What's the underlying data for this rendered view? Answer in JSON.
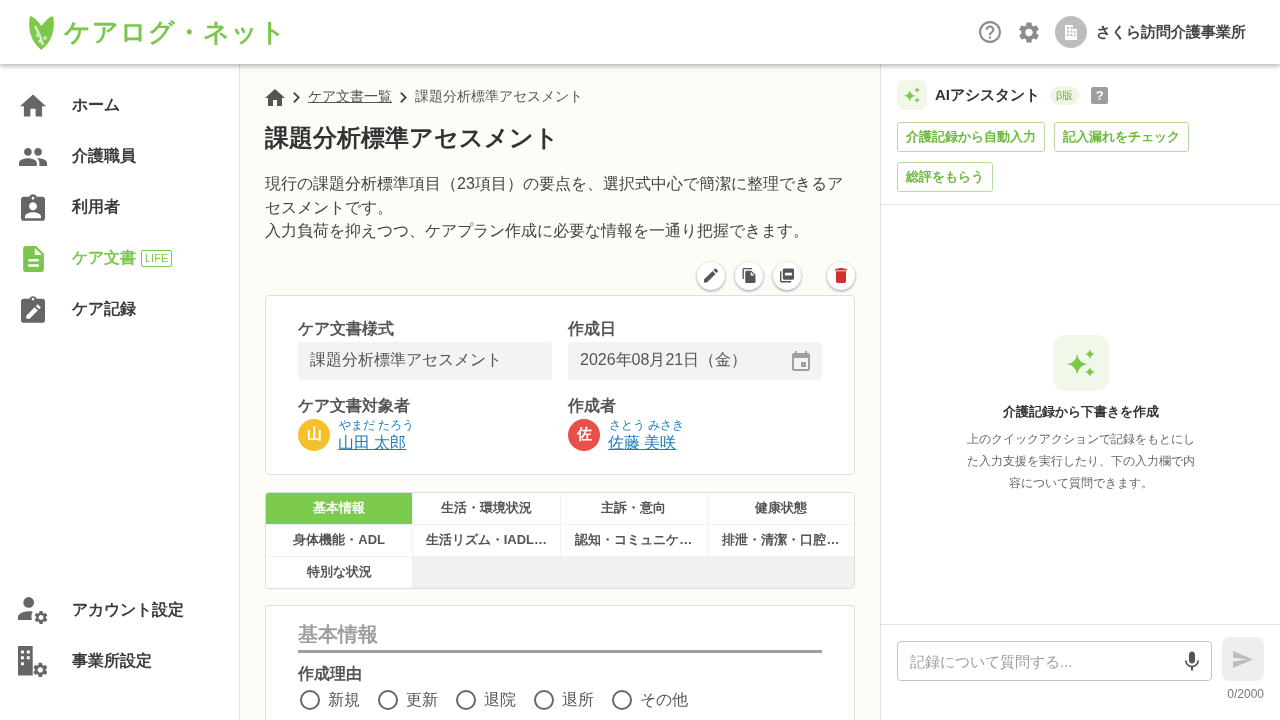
{
  "header": {
    "logo": "ケアログ・ネット",
    "account": "さくら訪問介護事業所"
  },
  "sidebar": {
    "items": [
      {
        "label": "ホーム",
        "selected": false
      },
      {
        "label": "介護職員",
        "selected": false
      },
      {
        "label": "利用者",
        "selected": false
      },
      {
        "label": "ケア文書",
        "selected": true,
        "badge": "LIFE"
      },
      {
        "label": "ケア記録",
        "selected": false
      }
    ],
    "bottom_items": [
      {
        "label": "アカウント設定",
        "selected": false
      },
      {
        "label": "事業所設定",
        "selected": false
      }
    ]
  },
  "breadcrumb": [
    {
      "label": "ケア文書一覧",
      "kind": "link"
    },
    {
      "label": "課題分析標準アセスメント",
      "kind": "current"
    }
  ],
  "page": {
    "title": "課題分析標準アセスメント",
    "description": [
      "現行の課題分析標準項目（23項目）の要点を、選択式中心で簡潔に整理できるアセスメントです。",
      "入力負荷を抑えつつ、ケアプラン作成に必要な情報を一通り把握できます。"
    ]
  },
  "document_info": {
    "fields": [
      {
        "label": "ケア文書様式",
        "value": "課題分析標準アセスメント",
        "kind": "text"
      },
      {
        "label": "作成日",
        "value": "2026年08月21日（金）",
        "kind": "date"
      }
    ],
    "people": [
      {
        "label": "ケア文書対象者",
        "initial": "山",
        "reading": "やまだ たろう",
        "name": "山田 太郎",
        "color": "#f6c02b"
      },
      {
        "label": "作成者",
        "initial": "佐",
        "reading": "さとう みさき",
        "name": "佐藤 美咲",
        "color": "#e8504a"
      }
    ]
  },
  "section_tabs": [
    {
      "label": "基本情報",
      "selected": true
    },
    {
      "label": "生活・環境状況",
      "selected": false
    },
    {
      "label": "主訴・意向",
      "selected": false
    },
    {
      "label": "健康状態",
      "selected": false
    },
    {
      "label": "身体機能・ADL",
      "selected": false
    },
    {
      "label": "生活リズム・IADL…",
      "selected": false
    },
    {
      "label": "認知・コミュニケ…",
      "selected": false
    },
    {
      "label": "排泄・清潔・口腔…",
      "selected": false
    },
    {
      "label": "特別な状況",
      "selected": false
    }
  ],
  "section": {
    "heading": "基本情報",
    "question": "作成理由",
    "options": [
      {
        "label": "新規",
        "selected": false
      },
      {
        "label": "更新",
        "selected": false
      },
      {
        "label": "退院",
        "selected": false
      },
      {
        "label": "退所",
        "selected": false
      },
      {
        "label": "その他",
        "selected": false
      }
    ]
  },
  "assistant": {
    "title": "AIアシスタント",
    "badge": "β版",
    "help": "?",
    "actions": [
      "介護記録から自動入力",
      "記入漏れをチェック",
      "総評をもらう"
    ],
    "empty_state": {
      "title": "介護記録から下書きを作成",
      "text": "上のクイックアクションで記録をもとにした入力支援を実行したり、下の入力欄で内容について質問できます。"
    },
    "input": {
      "placeholder": "記録について質問する..."
    },
    "send": {
      "disabled": true
    },
    "counter": "0/2000"
  }
}
